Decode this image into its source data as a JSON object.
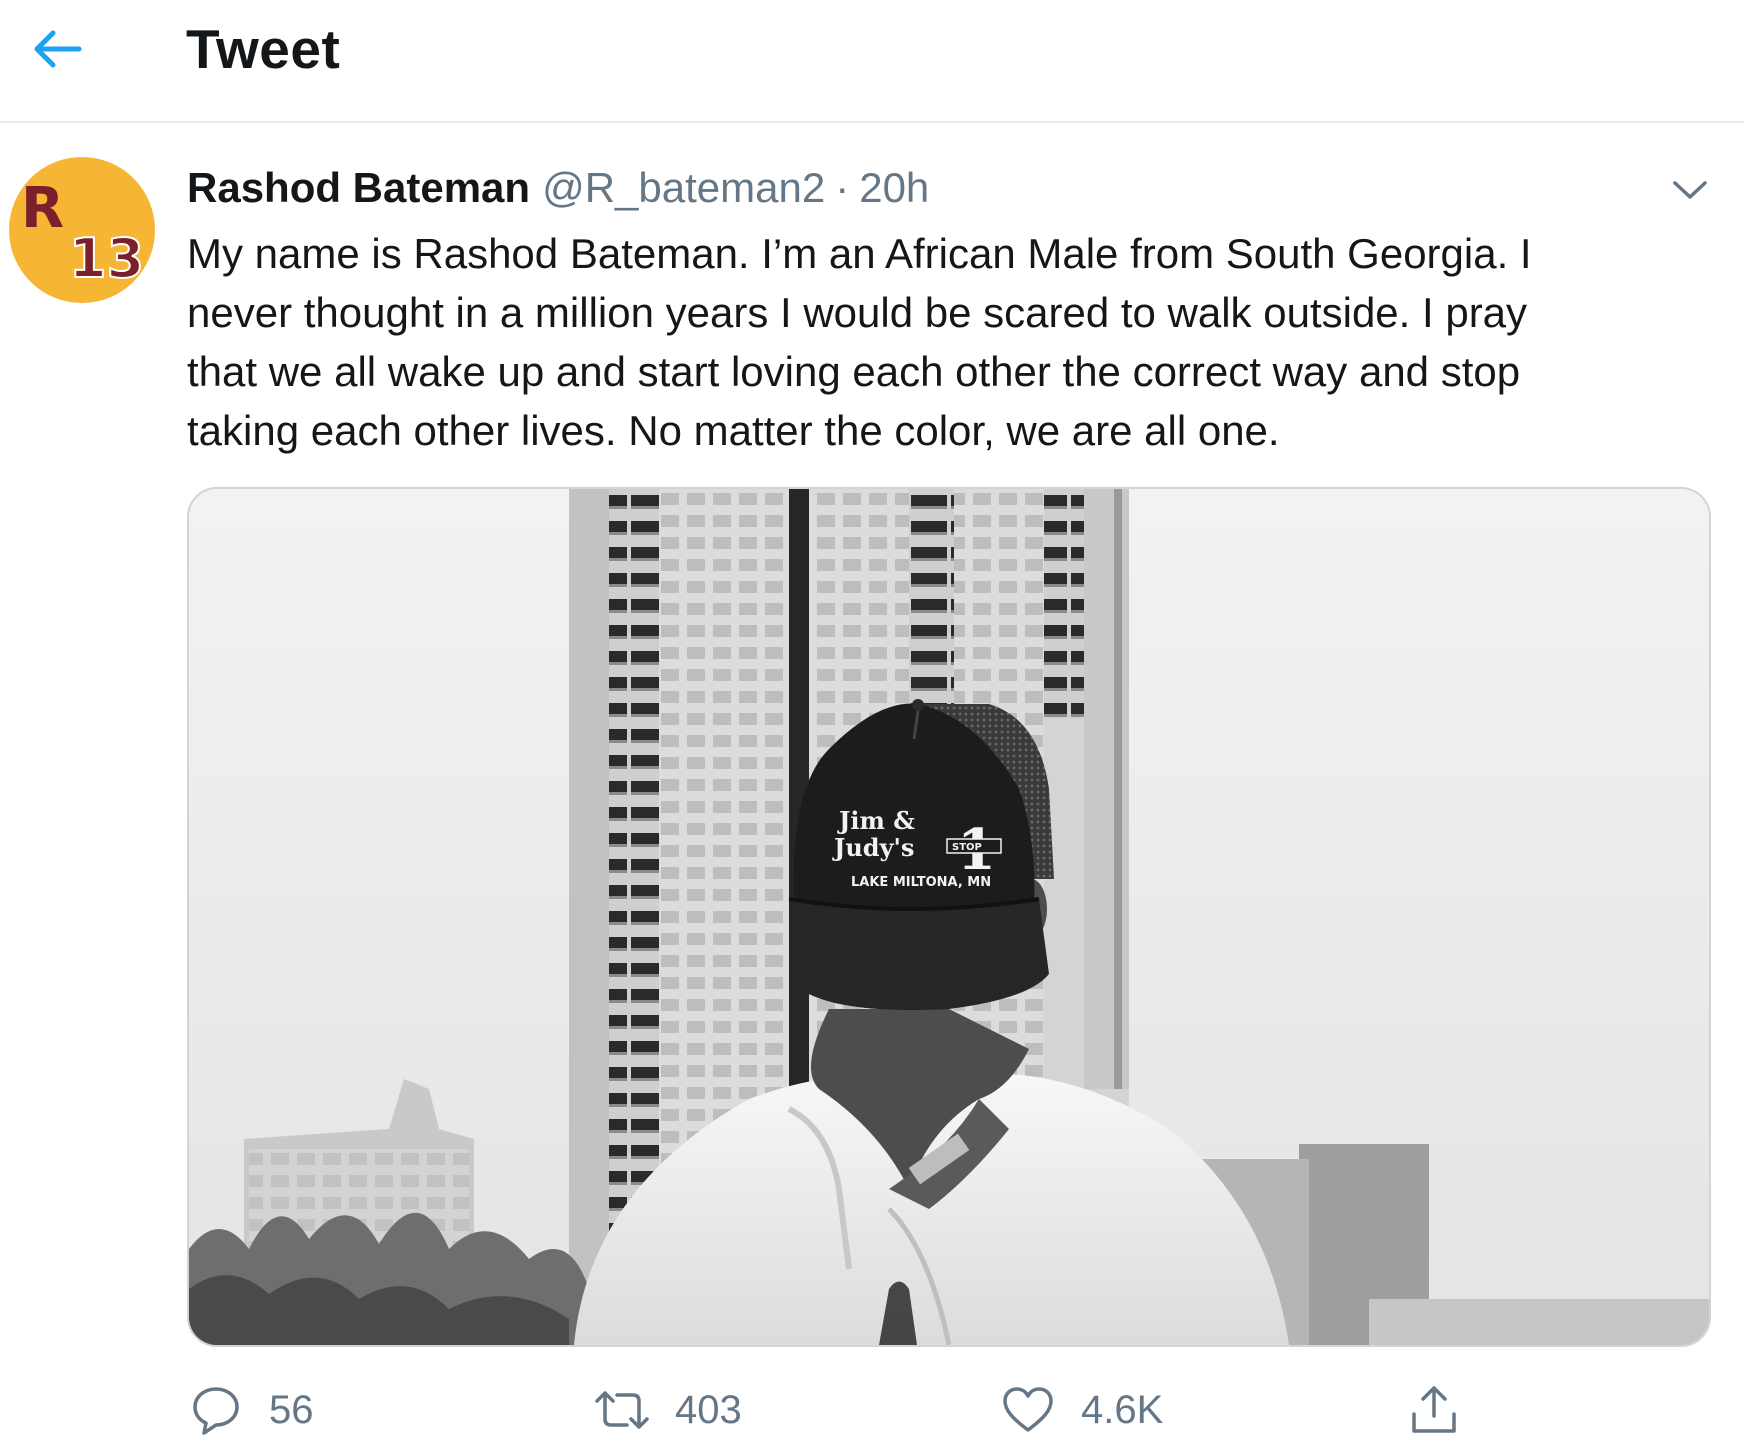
{
  "header": {
    "title": "Tweet",
    "back_icon": "arrow-left-icon",
    "accent_color": "#1da1f2"
  },
  "tweet": {
    "author_name": "Rashod Bateman",
    "author_handle": "@R_bateman2",
    "separator": "·",
    "time": "20h",
    "avatar_text_top": "R",
    "avatar_text_bottom": "13",
    "text": "My name is Rashod Bateman. I’m an African Male from South Georgia. I\nnever thought in a million years I would be scared to walk outside. I pray\nthat we all wake up and start loving each other the correct way and stop\ntaking each other lives. No matter the color, we are all one.",
    "media": {
      "hat_line1": "Jim &",
      "hat_line2": "Judy's",
      "hat_number": "1",
      "hat_stop": "STOP",
      "hat_location": "LAKE MILTONA, MN"
    }
  },
  "actions": {
    "reply_count": "56",
    "retweet_count": "403",
    "like_count": "4.6K",
    "icons": [
      "reply-icon",
      "retweet-icon",
      "like-icon",
      "share-icon"
    ]
  }
}
